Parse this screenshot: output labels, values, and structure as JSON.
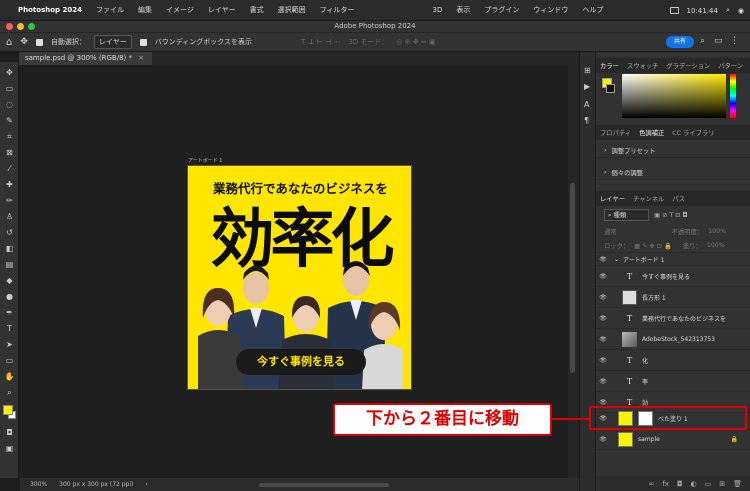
{
  "menubar": {
    "apple": "",
    "items": [
      "Photoshop 2024",
      "ファイル",
      "編集",
      "イメージ",
      "レイヤー",
      "書式",
      "選択範囲",
      "フィルター",
      "3D",
      "表示",
      "プラグイン",
      "ウィンドウ",
      "ヘルプ"
    ],
    "clock": "10:41:44"
  },
  "window": {
    "title": "Adobe Photoshop 2024"
  },
  "options": {
    "auto_select_label": "自動選択：",
    "auto_select_value": "レイヤー",
    "bounding_box_label": "バウンディングボックスを表示",
    "mode_3d": "3D モード：",
    "share_label": "共有"
  },
  "document": {
    "tab_label": "sample.psd @ 300% (RGB/8) *",
    "zoom": "300%",
    "size_info": "300 px x 300 px (72 ppi)"
  },
  "artboard": {
    "label": "アートボード 1",
    "headline": "業務代行であなたのビジネスを",
    "big_text": "効率化",
    "cta": "今すぐ事例を見る"
  },
  "colors": {
    "accent": "#fff200",
    "annotation_red": "#e00000",
    "share_blue": "#1473e6"
  },
  "panels": {
    "color_tabs": [
      "カラー",
      "スウォッチ",
      "グラデーション",
      "パターン"
    ],
    "props_tabs": [
      "プロパティ",
      "色調補正",
      "CC ライブラリ"
    ],
    "adjust_presets": "調整プリセット",
    "single_adjust": "個々の調整",
    "layer_tabs": [
      "レイヤー",
      "チャンネル",
      "パス"
    ],
    "kind_label": "種類",
    "blend_mode": "通常",
    "opacity_label": "不透明度：",
    "opacity_value": "100%",
    "lock_label": "ロック：",
    "fill_label": "塗り：",
    "fill_value": "100%"
  },
  "layers": [
    {
      "name": "アートボード 1",
      "kind": "group"
    },
    {
      "name": "今すぐ事例を見る",
      "kind": "text"
    },
    {
      "name": "長方形 1",
      "kind": "shape"
    },
    {
      "name": "業務代行であなたのビジネスを",
      "kind": "text"
    },
    {
      "name": "AdobeStock_542313753",
      "kind": "photo"
    },
    {
      "name": "化",
      "kind": "text"
    },
    {
      "name": "率",
      "kind": "text"
    },
    {
      "name": "効",
      "kind": "text"
    },
    {
      "name": "べた塗り 1",
      "kind": "fill"
    },
    {
      "name": "sample",
      "kind": "image"
    }
  ],
  "annotation": {
    "callout": "下から２番目に移動"
  }
}
